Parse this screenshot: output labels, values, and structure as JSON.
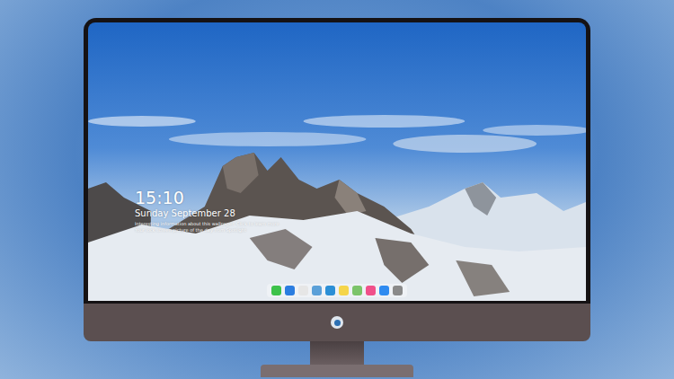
{
  "lock_screen": {
    "time": "15:10",
    "date": "Sunday September 28",
    "info_lines": [
      "Interesting information about this wallpaper. Click to learn more",
      "Your lock screen picture of the day from Spotlight"
    ]
  },
  "dock": {
    "apps": [
      {
        "color": "#3dc24a"
      },
      {
        "color": "#2b7de0"
      },
      {
        "color": "#e6e6e6"
      },
      {
        "color": "#5ba0d8"
      },
      {
        "color": "#2c8fd6"
      },
      {
        "color": "#f5d54a"
      },
      {
        "color": "#7cc46a"
      },
      {
        "color": "#f0508a"
      },
      {
        "color": "#2f8bf0"
      },
      {
        "color": "#8a8a8a"
      }
    ]
  }
}
